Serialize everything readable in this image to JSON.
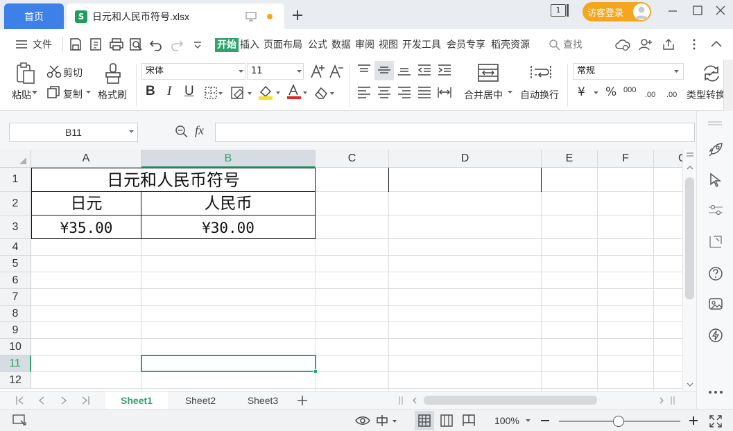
{
  "titlebar": {
    "home_tab": "首页",
    "doc_icon": "S",
    "doc_title": "日元和人民币符号.xlsx",
    "window_badge": "1",
    "login_label": "访客登录"
  },
  "menu": {
    "file": "文件",
    "tabs": [
      "开始",
      "插入",
      "页面布局",
      "公式",
      "数据",
      "审阅",
      "视图",
      "开发工具",
      "会员专享",
      "稻壳资源"
    ],
    "search": "查找"
  },
  "ribbon": {
    "paste": "粘贴",
    "cut": "剪切",
    "copy": "复制",
    "format_painter": "格式刷",
    "font_name": "宋体",
    "font_size": "11",
    "bold": "B",
    "italic": "I",
    "underline": "U",
    "merge_center": "合并居中",
    "wrap_text": "自动换行",
    "number_format": "常规",
    "currency": "¥",
    "percent": "%",
    "thousands": "000",
    "inc_decimal": ".00",
    "dec_decimal": ".00",
    "type_convert": "类型转换"
  },
  "formula_bar": {
    "name_box": "B11",
    "fx": "fx",
    "content": ""
  },
  "sheet": {
    "columns": [
      "A",
      "B",
      "C",
      "D",
      "E",
      "F",
      "G"
    ],
    "rows": [
      "1",
      "2",
      "3",
      "4",
      "5",
      "6",
      "7",
      "8",
      "9",
      "10",
      "11",
      "12"
    ],
    "cells": {
      "A1": "日元和人民币符号",
      "A2": "日元",
      "B2": "人民币",
      "A3": "¥35.00",
      "B3": "¥30.00"
    },
    "active_cell": "B11"
  },
  "sheet_tabs": [
    "Sheet1",
    "Sheet2",
    "Sheet3"
  ],
  "status": {
    "zoom": "100%",
    "zoom_level": 1.0
  },
  "colors": {
    "accent": "#2fa36d",
    "home_tab": "#3c80e8",
    "login": "#f4a61f"
  }
}
